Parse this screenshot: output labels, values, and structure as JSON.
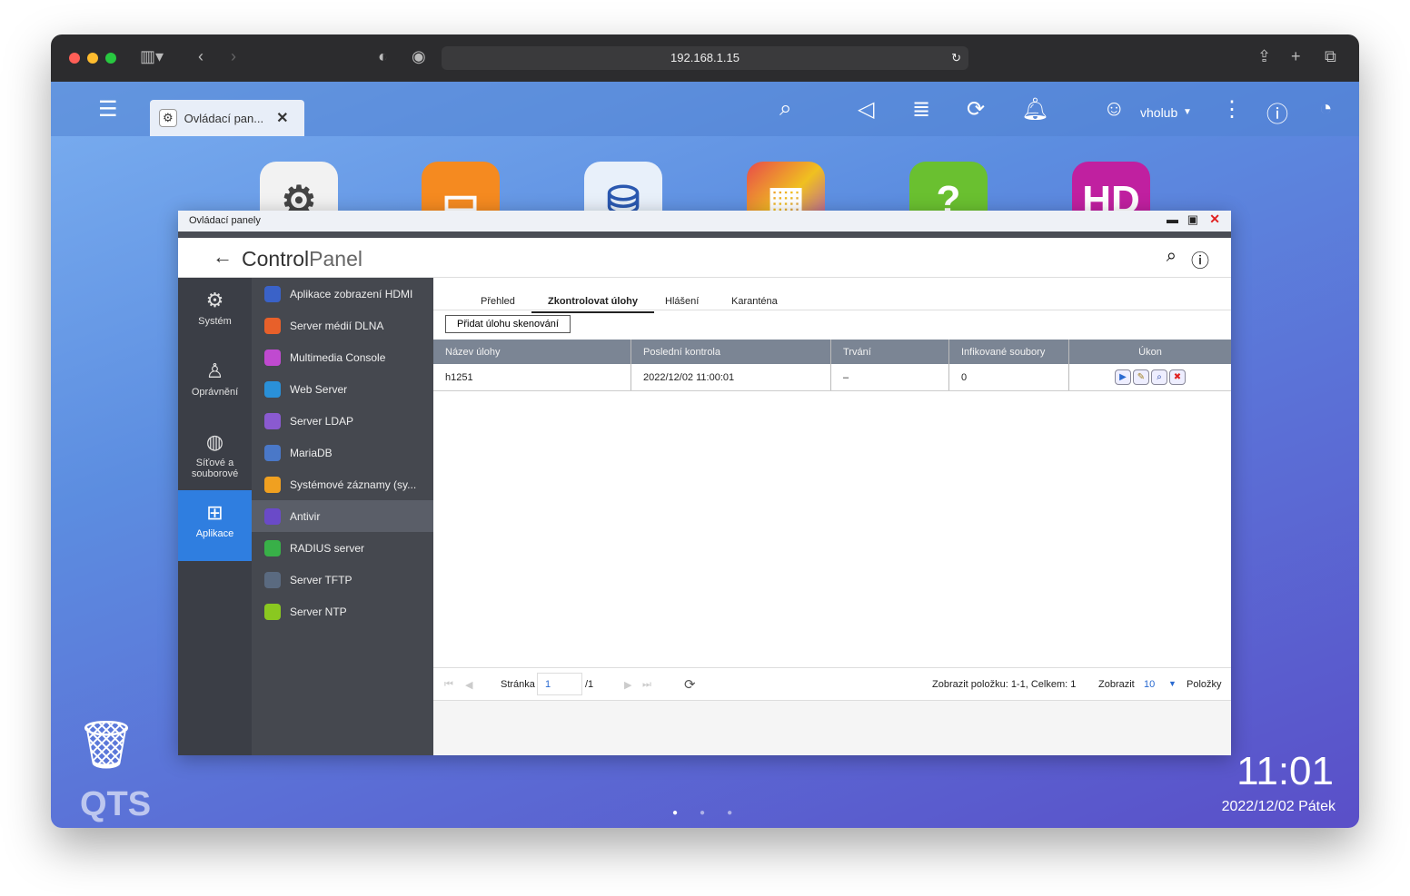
{
  "browser": {
    "url": "192.168.1.15"
  },
  "qts": {
    "tab_label": "Ovládací pan...",
    "user": "vholub",
    "logo": "QTS",
    "time": "11:01",
    "date": "2022/12/02 Pátek"
  },
  "window": {
    "title": "Ovládací panely",
    "header_bold": "Control",
    "header_light": "Panel"
  },
  "categories": [
    {
      "label": "Systém",
      "icon": "gear-icon"
    },
    {
      "label": "Oprávnění",
      "icon": "user-icon"
    },
    {
      "label": "Síťové a souborové",
      "icon": "globe-icon"
    },
    {
      "label": "Aplikace",
      "icon": "apps-icon",
      "active": true
    }
  ],
  "apps": [
    {
      "label": "Aplikace zobrazení HDMI",
      "color": "#3a62c8"
    },
    {
      "label": "Server médií DLNA",
      "color": "#e8602a"
    },
    {
      "label": "Multimedia Console",
      "color": "#c04ad0"
    },
    {
      "label": "Web Server",
      "color": "#2a90d8"
    },
    {
      "label": "Server LDAP",
      "color": "#8a5ad0"
    },
    {
      "label": "MariaDB",
      "color": "#4a78c8"
    },
    {
      "label": "Systémové záznamy (sy...",
      "color": "#f0a020"
    },
    {
      "label": "Antivir",
      "color": "#6a4ac8",
      "active": true
    },
    {
      "label": "RADIUS server",
      "color": "#38b048"
    },
    {
      "label": "Server TFTP",
      "color": "#5a6a80"
    },
    {
      "label": "Server NTP",
      "color": "#8ac820"
    }
  ],
  "tabs": [
    "Přehled",
    "Zkontrolovat úlohy",
    "Hlášení",
    "Karanténa"
  ],
  "active_tab": "Zkontrolovat úlohy",
  "add_button": "Přidat úlohu skenování",
  "table": {
    "headers": [
      "Název úlohy",
      "Poslední kontrola",
      "Trvání",
      "Infikované soubory",
      "Úkon"
    ],
    "rows": [
      [
        "h1251",
        "2022/12/02 11:00:01",
        "–",
        "0"
      ]
    ]
  },
  "pagination": {
    "page_label": "Stránka",
    "page": "1",
    "total_pages": "/1",
    "summary": "Zobrazit položku: 1-1, Celkem: 1",
    "show_label": "Zobrazit",
    "per_page": "10",
    "items_label": "Položky"
  }
}
